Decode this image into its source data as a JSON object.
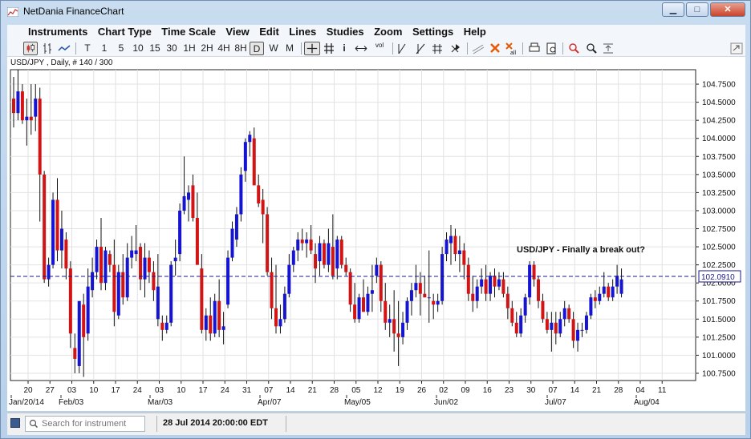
{
  "window": {
    "title": "NetDania FinanceChart",
    "buttons": {
      "minimize": "▁",
      "maximize": "□",
      "close": "✕"
    }
  },
  "menu": [
    "Instruments",
    "Chart Type",
    "Time Scale",
    "View",
    "Edit",
    "Lines",
    "Studies",
    "Zoom",
    "Settings",
    "Help"
  ],
  "toolbar": {
    "timescale": [
      "T",
      "1",
      "5",
      "10",
      "15",
      "30",
      "1H",
      "2H",
      "4H",
      "8H",
      "D",
      "W",
      "M"
    ],
    "selected_timescale": "D",
    "icons": [
      "chart-type-icon",
      "bar-chart-icon",
      "line-chart-icon",
      "crosshair-icon",
      "grid-icon",
      "info-icon",
      "pan-icon",
      "volume-icon",
      "trendline-icon",
      "ray-icon",
      "fork-icon",
      "cursor-icon",
      "channel-icon",
      "delete-icon",
      "delete-all-icon",
      "print-icon",
      "print-preview-icon",
      "zoom-in-icon",
      "zoom-out-icon",
      "fit-icon",
      "detach-icon"
    ],
    "volume_label": "vol"
  },
  "chart_caption": "USD/JPY , Daily, # 140 / 300",
  "chart_data": {
    "type": "candlestick",
    "symbol": "USD/JPY",
    "interval": "Daily",
    "annotation": "USD/JPY - Finally a break out?",
    "current_price_label": "102.0910",
    "current_price": 102.091,
    "y_ticks": [
      "104.7500",
      "104.5000",
      "104.2500",
      "104.0000",
      "103.7500",
      "103.5000",
      "103.2500",
      "103.0000",
      "102.7500",
      "102.5000",
      "102.2500",
      "102.0000",
      "101.7500",
      "101.5000",
      "101.2500",
      "101.0000",
      "100.7500"
    ],
    "ylim": [
      100.65,
      104.95
    ],
    "x_ticks": [
      "20",
      "27",
      "03",
      "10",
      "17",
      "24",
      "03",
      "10",
      "17",
      "24",
      "31",
      "07",
      "14",
      "21",
      "28",
      "05",
      "12",
      "19",
      "26",
      "02",
      "09",
      "16",
      "23",
      "30",
      "07",
      "14",
      "21",
      "28",
      "04",
      "11"
    ],
    "month_labels": [
      "Jan/20/14",
      "Feb/03",
      "Mar/03",
      "Apr/07",
      "May/05",
      "Jun/02",
      "Jul/07",
      "Aug/04"
    ],
    "up_color": "#1414d2",
    "down_color": "#d21414",
    "grid": true,
    "candles": [
      [
        104.55,
        104.85,
        104.15,
        104.35
      ],
      [
        104.35,
        104.95,
        104.25,
        104.65
      ],
      [
        104.65,
        104.75,
        104.2,
        104.25
      ],
      [
        104.25,
        104.55,
        103.9,
        104.3
      ],
      [
        104.3,
        104.75,
        104.05,
        104.25
      ],
      [
        104.3,
        104.75,
        104.1,
        104.55
      ],
      [
        104.55,
        104.7,
        102.85,
        103.5
      ],
      [
        103.5,
        103.55,
        102.0,
        102.05
      ],
      [
        102.05,
        102.35,
        101.95,
        102.25
      ],
      [
        102.25,
        103.25,
        102.2,
        103.15
      ],
      [
        103.15,
        103.45,
        102.3,
        102.45
      ],
      [
        102.45,
        103.0,
        102.2,
        102.75
      ],
      [
        102.6,
        102.7,
        102.05,
        102.2
      ],
      [
        102.2,
        102.3,
        101.1,
        101.3
      ],
      [
        101.1,
        101.3,
        100.75,
        100.95
      ],
      [
        100.85,
        101.7,
        100.75,
        101.75
      ],
      [
        101.7,
        101.85,
        100.7,
        101.25
      ],
      [
        101.3,
        102.2,
        101.2,
        101.95
      ],
      [
        101.9,
        102.35,
        101.8,
        102.15
      ],
      [
        102.15,
        102.6,
        102.05,
        102.5
      ],
      [
        102.5,
        102.9,
        101.9,
        102.0
      ],
      [
        102.0,
        102.5,
        101.9,
        102.45
      ],
      [
        102.4,
        102.45,
        102.15,
        102.25
      ],
      [
        102.25,
        102.6,
        101.4,
        101.6
      ],
      [
        101.55,
        102.25,
        101.5,
        102.15
      ],
      [
        102.15,
        102.4,
        101.7,
        101.8
      ],
      [
        101.8,
        102.55,
        101.75,
        102.35
      ],
      [
        102.35,
        102.65,
        102.2,
        102.45
      ],
      [
        102.4,
        102.8,
        102.3,
        102.45
      ],
      [
        102.5,
        102.55,
        101.9,
        102.05
      ],
      [
        102.05,
        102.55,
        101.8,
        102.35
      ],
      [
        102.35,
        102.45,
        102.0,
        102.15
      ],
      [
        102.15,
        102.3,
        101.75,
        101.9
      ],
      [
        101.5,
        102.4,
        101.4,
        101.95
      ],
      [
        101.45,
        101.55,
        101.2,
        101.35
      ],
      [
        101.35,
        101.55,
        101.3,
        101.45
      ],
      [
        101.45,
        102.3,
        101.4,
        102.25
      ],
      [
        102.3,
        102.6,
        102.1,
        102.35
      ],
      [
        102.4,
        103.1,
        102.3,
        103.0
      ],
      [
        103.0,
        103.75,
        102.95,
        103.2
      ],
      [
        103.15,
        103.35,
        102.85,
        103.25
      ],
      [
        103.35,
        103.5,
        102.85,
        102.9
      ],
      [
        102.9,
        103.25,
        102.3,
        102.25
      ],
      [
        102.2,
        102.4,
        101.3,
        101.35
      ],
      [
        101.35,
        101.65,
        101.2,
        101.55
      ],
      [
        101.55,
        101.8,
        101.2,
        101.3
      ],
      [
        101.3,
        101.85,
        101.25,
        101.75
      ],
      [
        101.75,
        102.05,
        101.25,
        101.35
      ],
      [
        101.35,
        101.6,
        101.15,
        101.4
      ],
      [
        101.7,
        102.45,
        101.65,
        102.35
      ],
      [
        102.35,
        102.85,
        102.3,
        102.75
      ],
      [
        102.6,
        103.05,
        102.5,
        102.95
      ],
      [
        102.95,
        103.6,
        102.85,
        103.5
      ],
      [
        103.55,
        104.0,
        103.4,
        103.95
      ],
      [
        103.95,
        104.1,
        103.75,
        104.05
      ],
      [
        104.0,
        104.15,
        103.6,
        103.35
      ],
      [
        103.35,
        103.5,
        103.05,
        103.1
      ],
      [
        103.15,
        103.3,
        102.55,
        102.95
      ],
      [
        102.95,
        103.05,
        102.1,
        102.15
      ],
      [
        102.15,
        102.35,
        101.5,
        101.65
      ],
      [
        101.65,
        102.25,
        101.3,
        101.4
      ],
      [
        101.4,
        101.7,
        101.3,
        101.5
      ],
      [
        101.5,
        101.95,
        101.45,
        101.85
      ],
      [
        101.85,
        102.4,
        101.8,
        102.25
      ],
      [
        102.25,
        102.5,
        102.15,
        102.45
      ],
      [
        102.45,
        102.7,
        102.3,
        102.6
      ],
      [
        102.6,
        102.75,
        102.45,
        102.55
      ],
      [
        102.55,
        102.7,
        102.35,
        102.6
      ],
      [
        102.6,
        102.8,
        102.4,
        102.45
      ],
      [
        102.4,
        102.55,
        102.0,
        102.2
      ],
      [
        102.3,
        102.65,
        102.1,
        102.55
      ],
      [
        102.55,
        102.6,
        102.2,
        102.25
      ],
      [
        102.25,
        102.75,
        102.15,
        102.55
      ],
      [
        102.5,
        102.95,
        102.05,
        102.1
      ],
      [
        102.2,
        102.65,
        102.05,
        102.6
      ],
      [
        102.6,
        102.65,
        102.2,
        102.25
      ],
      [
        102.25,
        102.35,
        102.1,
        102.15
      ],
      [
        102.15,
        102.2,
        101.6,
        101.7
      ],
      [
        101.7,
        102.0,
        101.45,
        101.5
      ],
      [
        101.5,
        101.85,
        101.45,
        101.8
      ],
      [
        101.8,
        102.05,
        101.6,
        101.6
      ],
      [
        101.6,
        101.95,
        101.55,
        101.85
      ],
      [
        101.85,
        102.25,
        101.6,
        101.9
      ],
      [
        102.1,
        102.35,
        102.0,
        102.25
      ],
      [
        102.25,
        102.3,
        101.6,
        101.75
      ],
      [
        101.75,
        102.0,
        101.35,
        101.45
      ],
      [
        101.45,
        101.7,
        101.25,
        101.5
      ],
      [
        101.5,
        101.9,
        101.05,
        101.3
      ],
      [
        101.3,
        101.75,
        100.85,
        101.25
      ],
      [
        101.25,
        101.6,
        101.15,
        101.45
      ],
      [
        101.45,
        101.8,
        101.35,
        101.75
      ],
      [
        101.75,
        102.0,
        101.55,
        101.9
      ],
      [
        101.9,
        102.25,
        101.8,
        102.0
      ],
      [
        102.0,
        102.15,
        101.55,
        101.85
      ],
      [
        101.85,
        102.1,
        101.8,
        101.8
      ],
      [
        101.8,
        102.45,
        101.45,
        101.8
      ],
      [
        101.75,
        101.85,
        101.5,
        101.7
      ],
      [
        101.7,
        101.85,
        101.6,
        101.75
      ],
      [
        101.75,
        102.5,
        101.7,
        102.4
      ],
      [
        102.4,
        102.7,
        102.3,
        102.6
      ],
      [
        102.55,
        102.8,
        102.25,
        102.65
      ],
      [
        102.65,
        102.75,
        102.3,
        102.4
      ],
      [
        102.4,
        102.65,
        102.15,
        102.45
      ],
      [
        102.45,
        102.55,
        102.05,
        102.25
      ],
      [
        102.25,
        102.35,
        101.75,
        101.85
      ],
      [
        101.85,
        102.1,
        101.6,
        101.75
      ],
      [
        101.75,
        102.05,
        101.65,
        101.95
      ],
      [
        101.95,
        102.2,
        101.85,
        102.05
      ],
      [
        102.05,
        102.25,
        101.75,
        101.85
      ],
      [
        101.85,
        102.15,
        101.75,
        102.1
      ],
      [
        102.1,
        102.2,
        101.8,
        101.95
      ],
      [
        101.95,
        102.15,
        101.9,
        102.05
      ],
      [
        102.05,
        102.15,
        101.8,
        101.85
      ],
      [
        101.85,
        101.95,
        101.5,
        101.65
      ],
      [
        101.65,
        101.75,
        101.4,
        101.45
      ],
      [
        101.45,
        101.6,
        101.25,
        101.3
      ],
      [
        101.3,
        101.65,
        101.25,
        101.55
      ],
      [
        101.55,
        101.85,
        101.45,
        101.8
      ],
      [
        101.8,
        102.3,
        101.7,
        102.25
      ],
      [
        102.25,
        102.3,
        101.95,
        102.05
      ],
      [
        102.05,
        102.1,
        101.65,
        101.75
      ],
      [
        101.75,
        101.85,
        101.45,
        101.5
      ],
      [
        101.5,
        101.6,
        101.3,
        101.35
      ],
      [
        101.35,
        101.6,
        101.05,
        101.45
      ],
      [
        101.45,
        101.6,
        101.15,
        101.3
      ],
      [
        101.3,
        101.6,
        101.25,
        101.5
      ],
      [
        101.5,
        101.75,
        101.4,
        101.65
      ],
      [
        101.65,
        101.7,
        101.45,
        101.5
      ],
      [
        101.5,
        101.6,
        101.1,
        101.2
      ],
      [
        101.2,
        101.45,
        101.05,
        101.35
      ],
      [
        101.35,
        101.45,
        101.25,
        101.35
      ],
      [
        101.35,
        101.6,
        101.3,
        101.55
      ],
      [
        101.55,
        101.85,
        101.5,
        101.8
      ],
      [
        101.8,
        101.9,
        101.65,
        101.75
      ],
      [
        101.75,
        101.95,
        101.7,
        101.85
      ],
      [
        101.85,
        102.15,
        101.8,
        101.95
      ],
      [
        101.95,
        102.0,
        101.75,
        101.8
      ],
      [
        101.8,
        102.05,
        101.75,
        101.95
      ],
      [
        101.95,
        102.25,
        101.85,
        102.1
      ],
      [
        101.85,
        102.2,
        101.8,
        102.05
      ]
    ]
  },
  "status": {
    "search_placeholder": "Search for instrument",
    "timestamp": "28 Jul 2014 20:00:00 EDT"
  }
}
